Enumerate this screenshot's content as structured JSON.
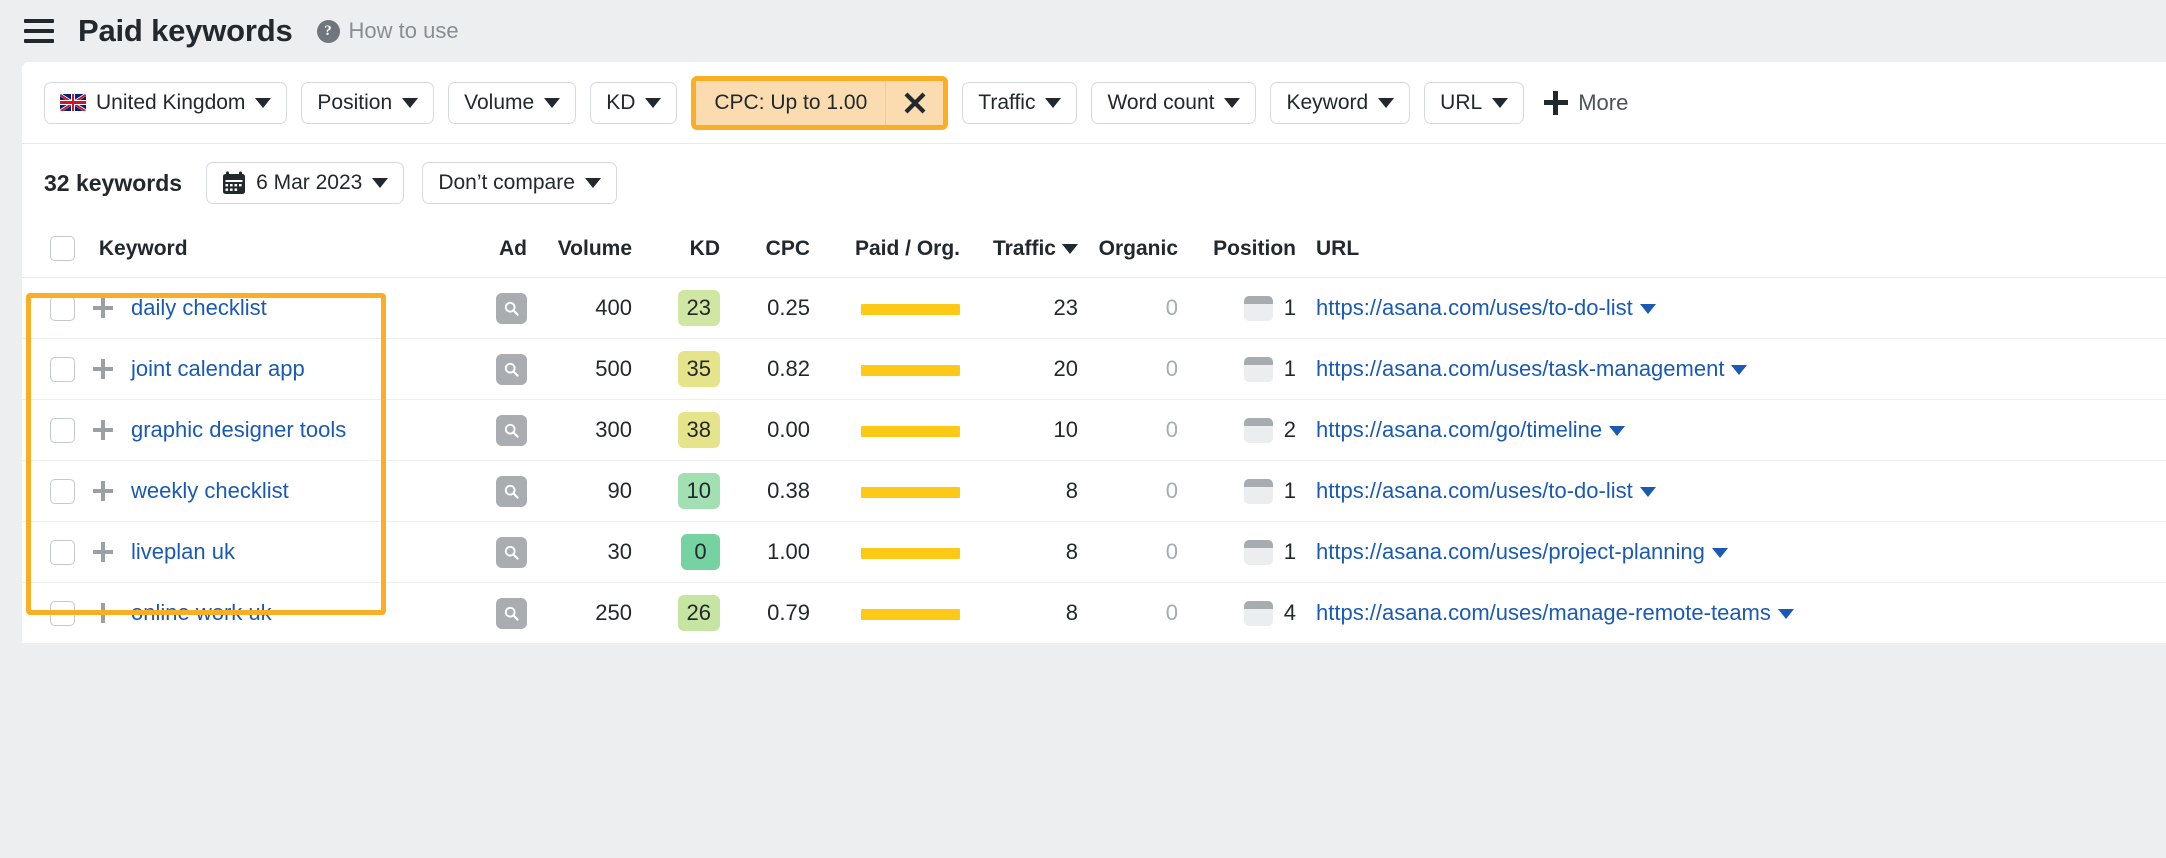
{
  "header": {
    "menu_icon": "hamburger-icon",
    "title": "Paid keywords",
    "help_icon": "question-mark-icon",
    "help_label": "How to use"
  },
  "filters": {
    "country": {
      "label": "United Kingdom",
      "flag": "uk-flag-icon"
    },
    "items": [
      "Position",
      "Volume",
      "KD",
      "Traffic",
      "Word count",
      "Keyword",
      "URL"
    ],
    "active_chip": {
      "label": "CPC: Up to 1.00",
      "close_icon": "close-icon",
      "accent": "#f9ae26",
      "fill": "#fbdcb0"
    },
    "more_label": "More",
    "more_icon": "plus-icon"
  },
  "toolbar": {
    "keyword_count": "32 keywords",
    "date": "6 Mar 2023",
    "date_icon": "calendar-icon",
    "compare": "Don’t compare"
  },
  "table": {
    "columns": [
      "Keyword",
      "Ad",
      "Volume",
      "KD",
      "CPC",
      "Paid / Org.",
      "Traffic",
      "Organic",
      "Position",
      "URL"
    ],
    "sorted_column": "Traffic",
    "sort_direction": "desc",
    "select_all_checkbox": false,
    "rows": [
      {
        "keyword": "daily checklist",
        "ad_icon": "magnifier-icon",
        "volume": "400",
        "kd": "23",
        "kd_color": "#cfe7a3",
        "cpc": "0.25",
        "paid_org_bar": 99,
        "traffic": "23",
        "organic": "0",
        "position": "1",
        "url": "https://asana.com/uses/to-do-list"
      },
      {
        "keyword": "joint calendar app",
        "ad_icon": "magnifier-icon",
        "volume": "500",
        "kd": "35",
        "kd_color": "#e6e48b",
        "cpc": "0.82",
        "paid_org_bar": 99,
        "traffic": "20",
        "organic": "0",
        "position": "1",
        "url": "https://asana.com/uses/task-management"
      },
      {
        "keyword": "graphic designer tools",
        "ad_icon": "magnifier-icon",
        "volume": "300",
        "kd": "38",
        "kd_color": "#e6e48b",
        "cpc": "0.00",
        "paid_org_bar": 99,
        "traffic": "10",
        "organic": "0",
        "position": "2",
        "url": "https://asana.com/go/timeline"
      },
      {
        "keyword": "weekly checklist",
        "ad_icon": "magnifier-icon",
        "volume": "90",
        "kd": "10",
        "kd_color": "#a2e0b4",
        "cpc": "0.38",
        "paid_org_bar": 99,
        "traffic": "8",
        "organic": "0",
        "position": "1",
        "url": "https://asana.com/uses/to-do-list"
      },
      {
        "keyword": "liveplan uk",
        "ad_icon": "magnifier-icon",
        "volume": "30",
        "kd": "0",
        "kd_color": "#74d3a0",
        "cpc": "1.00",
        "paid_org_bar": 99,
        "traffic": "8",
        "organic": "0",
        "position": "1",
        "url": "https://asana.com/uses/project-planning"
      },
      {
        "keyword": "online work uk",
        "ad_icon": "magnifier-icon",
        "volume": "250",
        "kd": "26",
        "kd_color": "#c6e5a3",
        "cpc": "0.79",
        "paid_org_bar": 99,
        "traffic": "8",
        "organic": "0",
        "position": "4",
        "url": "https://asana.com/uses/manage-remote-teams"
      }
    ]
  },
  "annotations": {
    "keyword_column_highlight_color": "#f9ae26",
    "cpc_filter_highlight_color": "#f9ae26"
  }
}
